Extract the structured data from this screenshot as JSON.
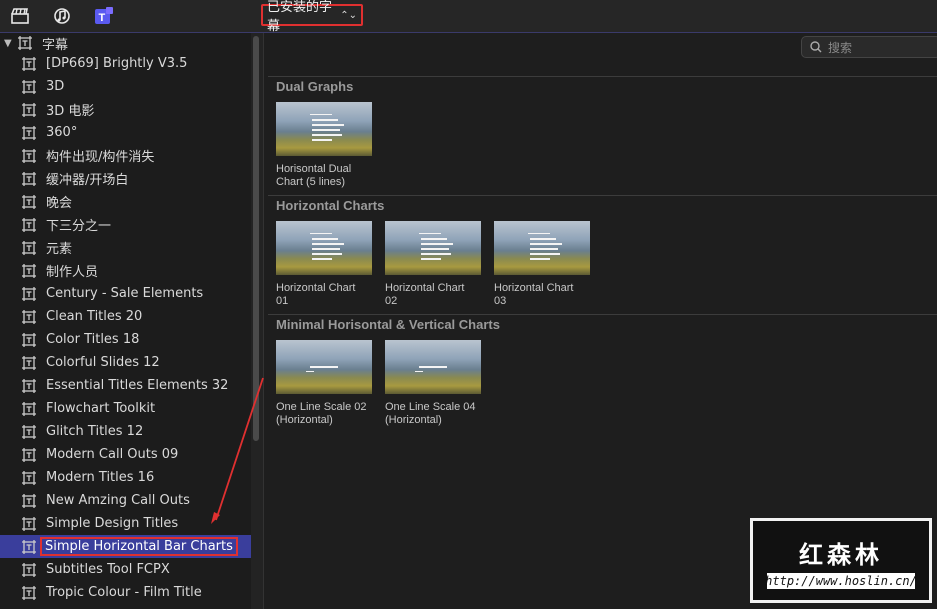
{
  "toolbar": {
    "icons": [
      "clapperboard-icon",
      "music-icon",
      "titles-icon"
    ],
    "dropdown_label": "已安装的字幕",
    "search_placeholder": "搜索"
  },
  "sidebar": {
    "root_label": "字幕",
    "items": [
      {
        "label": "[DP669] Brightly V3.5"
      },
      {
        "label": "3D"
      },
      {
        "label": "3D 电影"
      },
      {
        "label": "360°"
      },
      {
        "label": "构件出现/构件消失"
      },
      {
        "label": "缓冲器/开场白"
      },
      {
        "label": "晚会"
      },
      {
        "label": "下三分之一"
      },
      {
        "label": "元素"
      },
      {
        "label": "制作人员"
      },
      {
        "label": "Century - Sale Elements"
      },
      {
        "label": "Clean Titles 20"
      },
      {
        "label": "Color Titles 18"
      },
      {
        "label": "Colorful Slides 12"
      },
      {
        "label": "Essential Titles Elements 32"
      },
      {
        "label": "Flowchart Toolkit"
      },
      {
        "label": "Glitch Titles 12"
      },
      {
        "label": "Modern Call Outs 09"
      },
      {
        "label": "Modern Titles 16"
      },
      {
        "label": "New Amzing Call Outs"
      },
      {
        "label": "Simple Design Titles"
      },
      {
        "label": "Simple Horizontal Bar Charts",
        "selected": true
      },
      {
        "label": "Subtitles Tool FCPX"
      },
      {
        "label": "Tropic Colour - Film Title"
      }
    ]
  },
  "browser": {
    "sections": [
      {
        "title": "Dual Graphs",
        "items": [
          {
            "line1": "Horisontal Dual",
            "line2": "Chart (5 lines)"
          }
        ]
      },
      {
        "title": "Horizontal Charts",
        "items": [
          {
            "line1": "Horizontal Chart",
            "line2": "01"
          },
          {
            "line1": "Horizontal Chart",
            "line2": "02"
          },
          {
            "line1": "Horizontal Chart",
            "line2": "03"
          }
        ]
      },
      {
        "title": "Minimal Horisontal & Vertical Charts",
        "items": [
          {
            "line1": "One Line Scale 02",
            "line2": "(Horizontal)"
          },
          {
            "line1": "One Line Scale 04",
            "line2": "(Horizontal)"
          }
        ]
      }
    ]
  },
  "watermark": {
    "title": "红森林",
    "url": "http://www.hoslin.cn/"
  },
  "colors": {
    "selection": "#3a3e9c",
    "highlight_border": "#e03030",
    "arrow": "#e03030"
  }
}
